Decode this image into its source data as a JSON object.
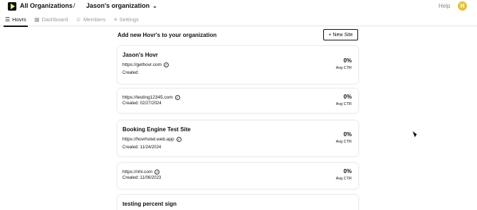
{
  "header": {
    "org_all": "All Organizations",
    "separator": "/",
    "org_current": "Jason's organization",
    "help": "Help",
    "avatar_initial": "H"
  },
  "tabs": [
    {
      "label": "Hovrs",
      "icon": "list-icon",
      "active": true
    },
    {
      "label": "Dashboard",
      "icon": "dashboard-icon",
      "active": false
    },
    {
      "label": "Members",
      "icon": "members-icon",
      "active": false
    },
    {
      "label": "Settings",
      "icon": "settings-icon",
      "active": false
    }
  ],
  "main": {
    "title": "Add new Hovr's to your organization",
    "new_site_label": "New Site"
  },
  "cards": [
    {
      "title": "Jason's Hovr",
      "url": "https://gethovr.com",
      "created": "Created:",
      "ctr": "0%",
      "ctr_label": "Avg CTR"
    },
    {
      "title": "",
      "url": "https://testing12345.com",
      "created": "Created: 02/27/2024",
      "ctr": "0%",
      "ctr_label": "Avg CTR"
    },
    {
      "title": "Booking Engine Test Site",
      "url": "https://hovrhotel.web.app",
      "created": "Created: 11/24/2024",
      "ctr": "0%",
      "ctr_label": "Avg CTR"
    },
    {
      "title": "",
      "url": "https://nhl.com",
      "created": "Created: 11/06/2023",
      "ctr": "0%",
      "ctr_label": "Avg CTR"
    },
    {
      "title": "testing percent sign",
      "url": "",
      "created": "",
      "ctr": "",
      "ctr_label": ""
    }
  ],
  "colors": {
    "accent": "#111111",
    "avatar": "#e6c23a",
    "logo_arrow": "#e8ff6b"
  }
}
